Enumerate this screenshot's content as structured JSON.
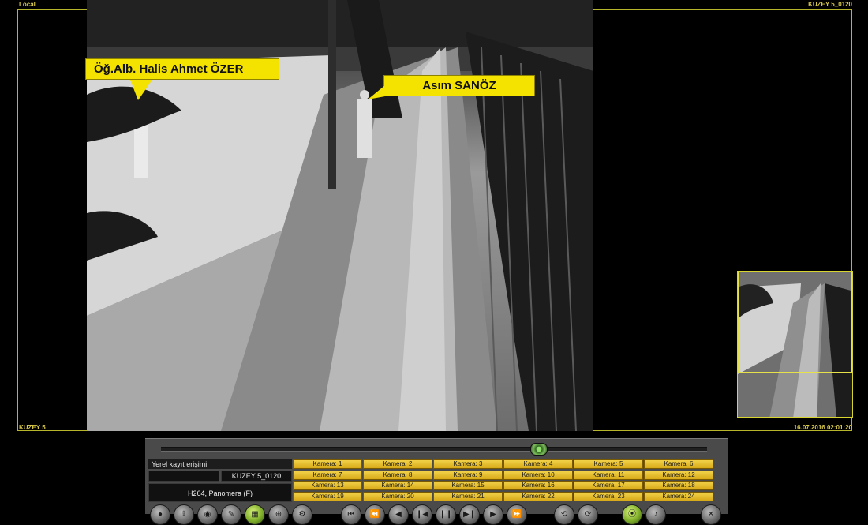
{
  "osd": {
    "top_left": "Local",
    "top_right": "KUZEY 5_0120",
    "bottom_left": "KUZEY 5",
    "bottom_right": "16.07.2016   02:01:20"
  },
  "annotations": {
    "person_left": "Öğ.Alb. Halis Ahmet ÖZER",
    "person_right": "Asım SANÖZ"
  },
  "panel": {
    "title": "Yerel kayıt erişimi",
    "camera_name": "KUZEY 5_0120",
    "codec": "H264, Panomera (F)",
    "cameras": [
      "Kamera: 1",
      "Kamera: 2",
      "Kamera: 3",
      "Kamera: 4",
      "Kamera: 5",
      "Kamera: 6",
      "Kamera: 7",
      "Kamera: 8",
      "Kamera: 9",
      "Kamera: 10",
      "Kamera: 11",
      "Kamera: 12",
      "Kamera: 13",
      "Kamera: 14",
      "Kamera: 15",
      "Kamera: 16",
      "Kamera: 17",
      "Kamera: 18",
      "Kamera: 19",
      "Kamera: 20",
      "Kamera: 21",
      "Kamera: 22",
      "Kamera: 23",
      "Kamera: 24"
    ]
  },
  "toolbar_icons": [
    "record-icon",
    "export-icon",
    "snapshot-icon",
    "tag-icon",
    "grid-icon",
    "zoom-icon",
    "settings-icon",
    "skip-start-icon",
    "rewind-icon",
    "step-back-icon",
    "prev-frame-icon",
    "pause-icon",
    "next-frame-icon",
    "step-forward-icon",
    "fast-forward-icon",
    "loop-icon",
    "sync-icon",
    "live-icon",
    "audio-icon",
    "close-icon"
  ]
}
